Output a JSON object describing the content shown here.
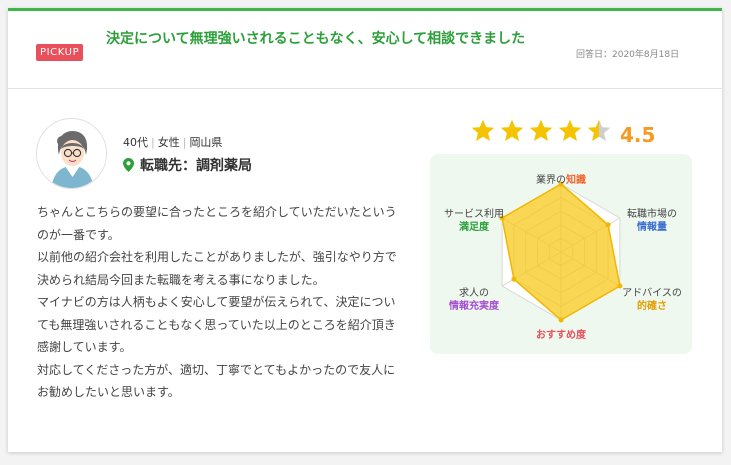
{
  "header": {
    "badge": "PICKUP",
    "title": "決定について無理強いされることもなく、安心して相談できました",
    "answer_date": "回答日：2020年8月18日"
  },
  "profile": {
    "age": "40代",
    "gender": "女性",
    "region": "岡山県",
    "job": "転職先：調剤薬局"
  },
  "review": {
    "paragraphs": [
      "ちゃんとこちらの要望に合ったところを紹介していただいたというのが一番です。",
      "以前他の紹介会社を利用したことがありましたが、強引なやり方で決められ結局今回また転職を考える事になりました。",
      "マイナビの方は人柄もよく安心して要望が伝えられて、決定についても無理強いされることもなく思っていた以上のところを紹介頂き感謝しています。",
      "対応してくださった方が、適切、丁寧でとてもよかったので友人にお勧めしたいと思います。"
    ]
  },
  "rating": {
    "score": "4.5",
    "value": 4.5,
    "max": 5
  },
  "radar": {
    "labels": [
      {
        "prefix": "業界の",
        "highlight": "知識",
        "color": "#f0642d"
      },
      {
        "prefix": "転職市場の",
        "highlight": "情報量",
        "color": "#3a6fd0"
      },
      {
        "prefix": "アドバイスの",
        "highlight": "的確さ",
        "color": "#e0a000"
      },
      {
        "prefix": "",
        "highlight": "おすすめ度",
        "color": "#e8505b"
      },
      {
        "prefix": "求人の",
        "highlight": "情報充実度",
        "color": "#a44fd0"
      },
      {
        "prefix": "サービス利用",
        "highlight": "満足度",
        "color": "#2d9f3a"
      }
    ],
    "values": [
      5,
      4,
      5,
      5,
      4,
      5
    ],
    "max": 5
  },
  "colors": {
    "accent": "#3fb649",
    "title_green": "#2d9f3a",
    "badge_red": "#e8505b",
    "star": "#f5c400",
    "score_orange": "#f59a23",
    "radar_fill": "#f8c81c"
  }
}
